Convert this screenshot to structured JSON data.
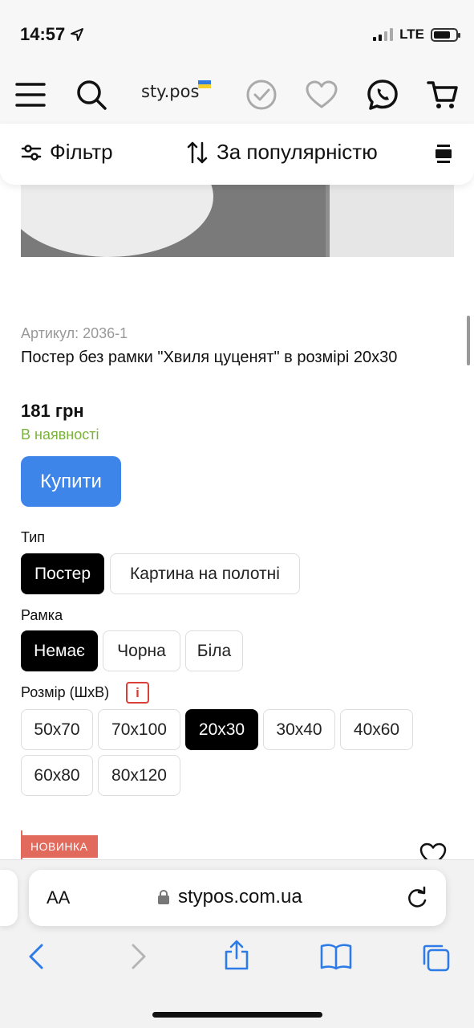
{
  "status_bar": {
    "time": "14:57",
    "network": "LTE"
  },
  "header": {
    "logo": "sty.pos"
  },
  "filter_bar": {
    "filter_label": "Фільтр",
    "sort_label": "За популярністю"
  },
  "product": {
    "article": "Артикул: 2036-1",
    "title": "Постер без рамки \"Хвиля цуценят\" в розмірі 20x30",
    "price": "181 грн",
    "stock": "В наявності",
    "buy_label": "Купити"
  },
  "options": {
    "type_label": "Тип",
    "types": [
      "Постер",
      "Картина на полотні"
    ],
    "frame_label": "Рамка",
    "frames": [
      "Немає",
      "Чорна",
      "Біла"
    ],
    "size_label": "Розмір (ШхВ)",
    "info_symbol": "i",
    "sizes": [
      "50x70",
      "70x100",
      "20x30",
      "30x40",
      "40x60",
      "60x80",
      "80x120"
    ]
  },
  "next_item": {
    "badge": "НОВИНКА"
  },
  "safari": {
    "text_size": "AA",
    "url": "stypos.com.ua"
  },
  "colors": {
    "buy": "#3d85e8",
    "stock": "#7bb33a",
    "badge": "#e16a5d",
    "info": "#d9403a"
  }
}
